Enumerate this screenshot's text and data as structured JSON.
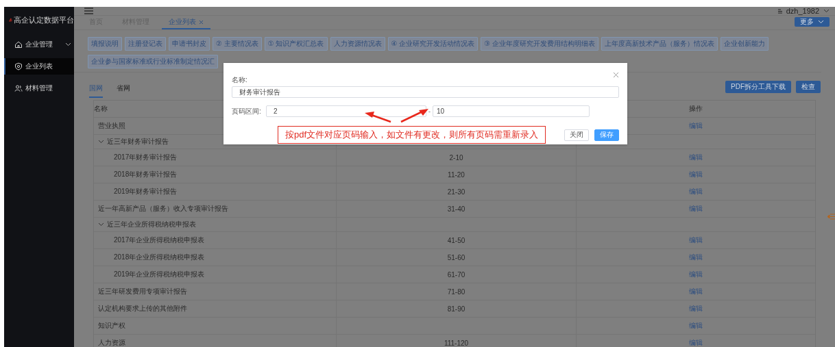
{
  "sidebar": {
    "logo": "高企认定数据平台",
    "items": [
      {
        "label": "企业管理",
        "kind": "submenu",
        "selected": false
      },
      {
        "label": "企业列表",
        "kind": "link",
        "selected": true
      },
      {
        "label": "材料管理",
        "kind": "link",
        "selected": false
      }
    ]
  },
  "header": {
    "user": "dzh_1982"
  },
  "tabs": [
    {
      "label": "首页",
      "selected": false,
      "closable": false
    },
    {
      "label": "材料管理",
      "selected": false,
      "closable": false
    },
    {
      "label": "企业列表",
      "selected": true,
      "closable": true
    }
  ],
  "more_button": "更多",
  "toolbar_buttons": [
    "填报说明",
    "注册登记表",
    "申请书封皮",
    "② 主要情况表",
    "① 知识产权汇总表",
    "人力资源情况表",
    "④ 企业研究开发活动情况表",
    "③ 企业年度研究开发费用结构明细表",
    "上年度高新技术产品（服务）情况表",
    "企业创新能力",
    "企业参与国家标准或行业标准制定情况汇"
  ],
  "subtabs": [
    {
      "label": "国网",
      "selected": true
    },
    {
      "label": "省网",
      "selected": false
    }
  ],
  "actions": [
    "PDF拆分工具下载",
    "检查"
  ],
  "table": {
    "column_headers": {
      "name": "名称",
      "action": "操作"
    },
    "rows": [
      {
        "name": "营业执照",
        "action": "编辑"
      },
      {
        "name": "近三年财务审计报告",
        "expanded": true,
        "children": [
          {
            "name": "2017年财务审计报告",
            "pages": "2-10",
            "action": "编辑"
          },
          {
            "name": "2018年财务审计报告",
            "pages": "11-20",
            "action": "编辑"
          },
          {
            "name": "2019年财务审计报告",
            "pages": "21-30",
            "action": "编辑"
          }
        ]
      },
      {
        "name": "近一年高新产品（服务）收入专项审计报告",
        "pages": "31-40",
        "action": "编辑"
      },
      {
        "name": "近三年企业所得税纳税申报表",
        "expanded": true,
        "children": [
          {
            "name": "2017年企业所得税纳税申报表",
            "pages": "41-50",
            "action": "编辑"
          },
          {
            "name": "2018年企业所得税纳税申报表",
            "pages": "51-60",
            "action": "编辑"
          },
          {
            "name": "2019年企业所得税纳税申报表",
            "pages": "61-70",
            "action": "编辑"
          }
        ]
      },
      {
        "name": "近三年研发费用专项审计报告",
        "pages": "71-80",
        "action": "编辑"
      },
      {
        "name": "认定机构要求上传的其他附件",
        "pages": "81-90",
        "action": "编辑"
      },
      {
        "name": "知识产权",
        "action": "编辑"
      },
      {
        "name": "人力资源",
        "pages": "111-120",
        "action": "编辑"
      }
    ]
  },
  "modal": {
    "name_label": "名称:",
    "name_value": "财务审计报告",
    "range_label": "页码区间:",
    "range_from": "2",
    "range_separator": "-",
    "range_to": "10",
    "note": "按pdf文件对应页码输入，如文件有更改，则所有页码需重新录入",
    "buttons": [
      {
        "label": "关闭",
        "kind": "default"
      },
      {
        "label": "保存",
        "kind": "primary"
      }
    ]
  }
}
